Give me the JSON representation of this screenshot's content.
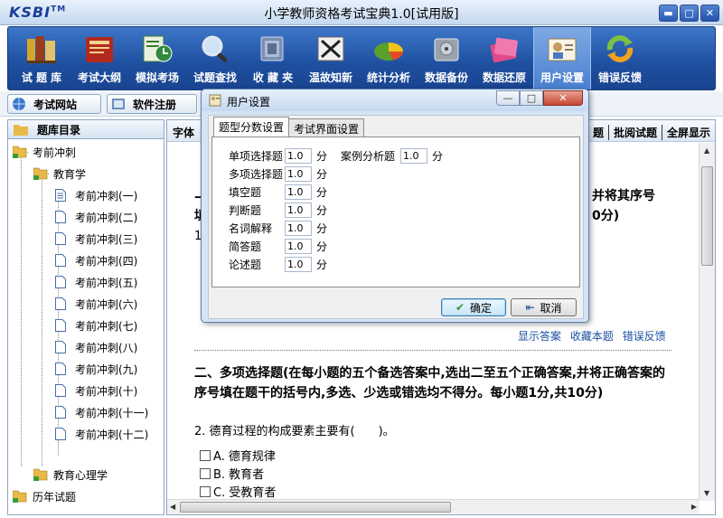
{
  "window": {
    "logo": "KSBI",
    "logo_tm": "TM",
    "title": "小学教师资格考试宝典1.0[试用版]",
    "min": "▬",
    "max": "□",
    "close": "✕"
  },
  "toolbar": {
    "items": [
      {
        "label": "试 题 库",
        "icon": "books-icon"
      },
      {
        "label": "考试大纲",
        "icon": "outline-book-icon"
      },
      {
        "label": "模拟考场",
        "icon": "mock-exam-icon"
      },
      {
        "label": "试题查找",
        "icon": "magnifier-icon"
      },
      {
        "label": "收 藏 夹",
        "icon": "favorites-icon"
      },
      {
        "label": "温故知新",
        "icon": "review-icon"
      },
      {
        "label": "统计分析",
        "icon": "pie-chart-icon"
      },
      {
        "label": "数据备份",
        "icon": "backup-disk-icon"
      },
      {
        "label": "数据还原",
        "icon": "restore-icon"
      },
      {
        "label": "用户设置",
        "icon": "user-settings-icon"
      },
      {
        "label": "错误反馈",
        "icon": "feedback-arrows-icon"
      }
    ],
    "active_index": 9
  },
  "rowbar": {
    "site": "考试网站",
    "register": "软件注册"
  },
  "tree": {
    "header": "题库目录",
    "root1": "考前冲刺",
    "sub1": "教育学",
    "items": [
      "考前冲刺(一)",
      "考前冲刺(二)",
      "考前冲刺(三)",
      "考前冲刺(四)",
      "考前冲刺(五)",
      "考前冲刺(六)",
      "考前冲刺(七)",
      "考前冲刺(八)",
      "考前冲刺(九)",
      "考前冲刺(十)",
      "考前冲刺(十一)",
      "考前冲刺(十二)"
    ],
    "sub2": "教育心理学",
    "root2": "历年试题"
  },
  "content": {
    "font_label": "字体",
    "right_links": [
      "题",
      "批阅试题",
      "全屏显示"
    ],
    "sec1_frag_right": "并将其序号",
    "sec1_frag_left": "填",
    "sec1_frag_right2": "0分)",
    "q1_num": "1",
    "answer_links": [
      "显示答案",
      "收藏本题",
      "错误反馈"
    ],
    "sec2_title": "二、多项选择题(在每小题的五个备选答案中,选出二至五个正确答案,并将正确答案的序号填在题干的括号内,多选、少选或错选均不得分。每小题1分,共10分)",
    "q2": "2. 德育过程的构成要素主要有(　　)。",
    "q2_options": [
      "A. 德育规律",
      "B. 教育者",
      "C. 受教育者"
    ]
  },
  "dialog": {
    "title": "用户设置",
    "tabs": [
      "题型分数设置",
      "考试界面设置"
    ],
    "unit": "分",
    "rows": [
      {
        "label": "单项选择题",
        "value": "1.0"
      },
      {
        "label": "多项选择题",
        "value": "1.0"
      },
      {
        "label": "填空题",
        "value": "1.0"
      },
      {
        "label": "判断题",
        "value": "1.0"
      },
      {
        "label": "名词解释",
        "value": "1.0"
      },
      {
        "label": "简答题",
        "value": "1.0"
      },
      {
        "label": "论述题",
        "value": "1.0"
      }
    ],
    "case": {
      "label": "案例分析题",
      "value": "1.0"
    },
    "ok": "确定",
    "cancel": "取消",
    "min": "—",
    "max": "□",
    "close": "✕"
  }
}
